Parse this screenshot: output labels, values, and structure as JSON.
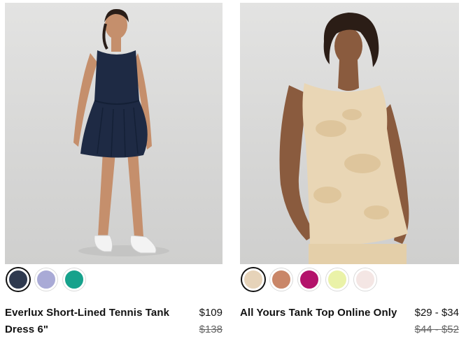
{
  "products": [
    {
      "name": "Everlux Short-Lined Tennis Tank Dress 6\"",
      "price": "$109",
      "original_price": "$138",
      "swatches": [
        {
          "color": "#2f3a4f",
          "selected": true
        },
        {
          "color": "#a9aad6",
          "selected": false
        },
        {
          "color": "#17a28c",
          "selected": false
        }
      ]
    },
    {
      "name": "All Yours Tank Top Online Only",
      "price": "$29 - $34",
      "original_price": "$44 - $52",
      "swatches": [
        {
          "color": "#e6d3b9",
          "selected": true
        },
        {
          "color": "#c98668",
          "selected": false
        },
        {
          "color": "#b3126a",
          "selected": false
        },
        {
          "color": "#eaf2a8",
          "selected": false
        },
        {
          "color": "#f4e6e4",
          "selected": false
        }
      ]
    }
  ]
}
